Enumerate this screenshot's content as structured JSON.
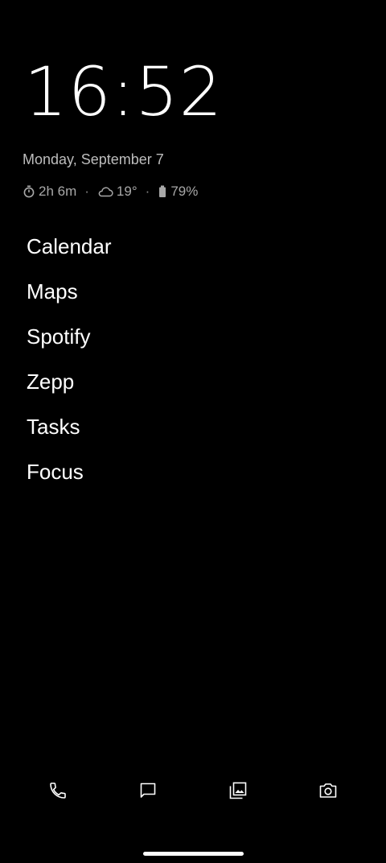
{
  "clock": {
    "time": "16:52"
  },
  "date": {
    "text": "Monday, September 7"
  },
  "info": {
    "timer": "2h 6m",
    "weather": "19°",
    "battery": "79%",
    "separator": "·"
  },
  "apps": [
    {
      "label": "Calendar"
    },
    {
      "label": "Maps"
    },
    {
      "label": "Spotify"
    },
    {
      "label": "Zepp"
    },
    {
      "label": "Tasks"
    },
    {
      "label": "Focus"
    }
  ],
  "dock": {
    "icons": [
      "phone-icon",
      "message-icon",
      "gallery-icon",
      "camera-icon"
    ]
  },
  "colors": {
    "background": "#000000",
    "primary_text": "#ffffff",
    "secondary_text": "#bdbdbd"
  }
}
